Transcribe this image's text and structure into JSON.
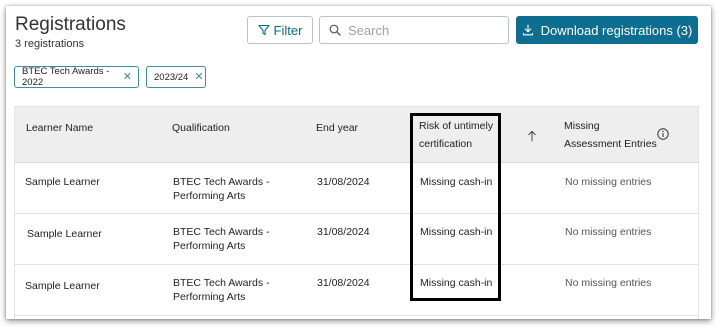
{
  "header": {
    "title": "Registrations",
    "count": "3 registrations"
  },
  "toolbar": {
    "filter_label": "Filter",
    "search_placeholder": "Search",
    "search_value": "",
    "download_label": "Download registrations (3)"
  },
  "active_filters": [
    {
      "label": "BTEC Tech Awards - 2022"
    },
    {
      "label": "2023/24"
    }
  ],
  "table": {
    "columns": {
      "learner_name": "Learner Name",
      "qualification": "Qualification",
      "end_year": "End year",
      "risk_line1": "Risk of untimely",
      "risk_line2": "certification",
      "missing_line1": "Missing",
      "missing_line2": "Assessment Entries"
    },
    "rows": [
      {
        "learner": "Sample Learner",
        "qual_line1": "BTEC Tech Awards -",
        "qual_line2": "Performing Arts",
        "end_year": "31/08/2024",
        "risk": "Missing cash-in",
        "missing_entries": "No missing entries"
      },
      {
        "learner": "Sample Learner",
        "qual_line1": "BTEC Tech Awards -",
        "qual_line2": "Performing Arts",
        "end_year": "31/08/2024",
        "risk": "Missing cash-in",
        "missing_entries": "No missing entries"
      },
      {
        "learner": "Sample Learner",
        "qual_line1": "BTEC Tech Awards -",
        "qual_line2": "Performing Arts",
        "end_year": "31/08/2024",
        "risk": "Missing cash-in",
        "missing_entries": "No missing entries"
      }
    ]
  },
  "icons": {
    "filter": "filter-icon",
    "search": "search-icon",
    "download": "download-icon",
    "chip_remove": "close-icon",
    "sort": "arrow-up-icon",
    "info": "info-icon"
  },
  "colors": {
    "primary": "#0d6e91",
    "chip_border": "#3e8ca6",
    "header_bg": "#eeeeee",
    "highlight_border": "#000000"
  }
}
